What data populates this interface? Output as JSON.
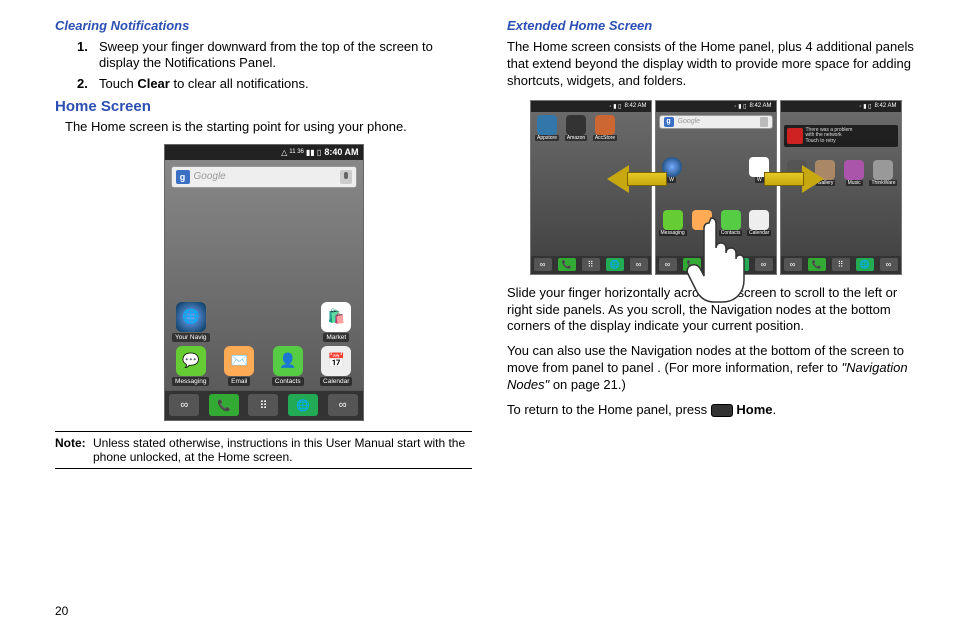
{
  "left": {
    "clearing_title": "Clearing Notifications",
    "step1_pre": "Sweep your finger downward from the top of the screen to display the Notifications Panel.",
    "step2_pre": "Touch ",
    "step2_bold": "Clear",
    "step2_post": " to clear all notifications.",
    "home_title": "Home Screen",
    "home_intro": "The Home screen is the starting point for using your phone.",
    "note_label": "Note:",
    "note_text": "Unless stated otherwise, instructions in this User Manual start with the phone unlocked, at the Home screen."
  },
  "right": {
    "ext_title": "Extended Home Screen",
    "ext_p1": "The Home screen consists of the Home panel, plus 4 additional panels that extend beyond the display width to provide more space for adding shortcuts, widgets, and folders.",
    "ext_p2": "Slide your finger horizontally across the screen to scroll to the left or right side panels. As you scroll, the Navigation nodes at the bottom corners of the display indicate your current position.",
    "ext_p3_a": "You can also use the Navigation nodes at the bottom of the screen to move from panel to panel . (For more information, refer to ",
    "ext_p3_ref": "\"Navigation Nodes\"",
    "ext_p3_b": " on page 21.)",
    "ext_p4_a": "To return to the Home panel, press ",
    "ext_p4_b": " Home",
    "ext_p4_c": "."
  },
  "phone": {
    "time": "8:40 AM",
    "status_indicator": "11 36",
    "search_placeholder": "Google",
    "apps": {
      "your_navig": "Your Navig",
      "market": "Market",
      "messaging": "Messaging",
      "email": "Email",
      "contacts": "Contacts",
      "calendar": "Calendar"
    }
  },
  "small": {
    "time": "8:42 AM",
    "left_apps": {
      "a1": "Appstore",
      "a2": "Amazon",
      "a3": "AccStore"
    },
    "mid_apps": {
      "m1": "W",
      "m2": "W",
      "b1": "Messaging",
      "b2": "Contacts",
      "b3": "Calendar"
    },
    "right_apps": {
      "r1": "Camera",
      "r2": "Gallery",
      "r3": "Music",
      "r4": "ThinkWare"
    },
    "notif_line1": "There was a problem",
    "notif_line2": "with the network",
    "notif_line3": "Touch to retry"
  },
  "page_number": "20"
}
